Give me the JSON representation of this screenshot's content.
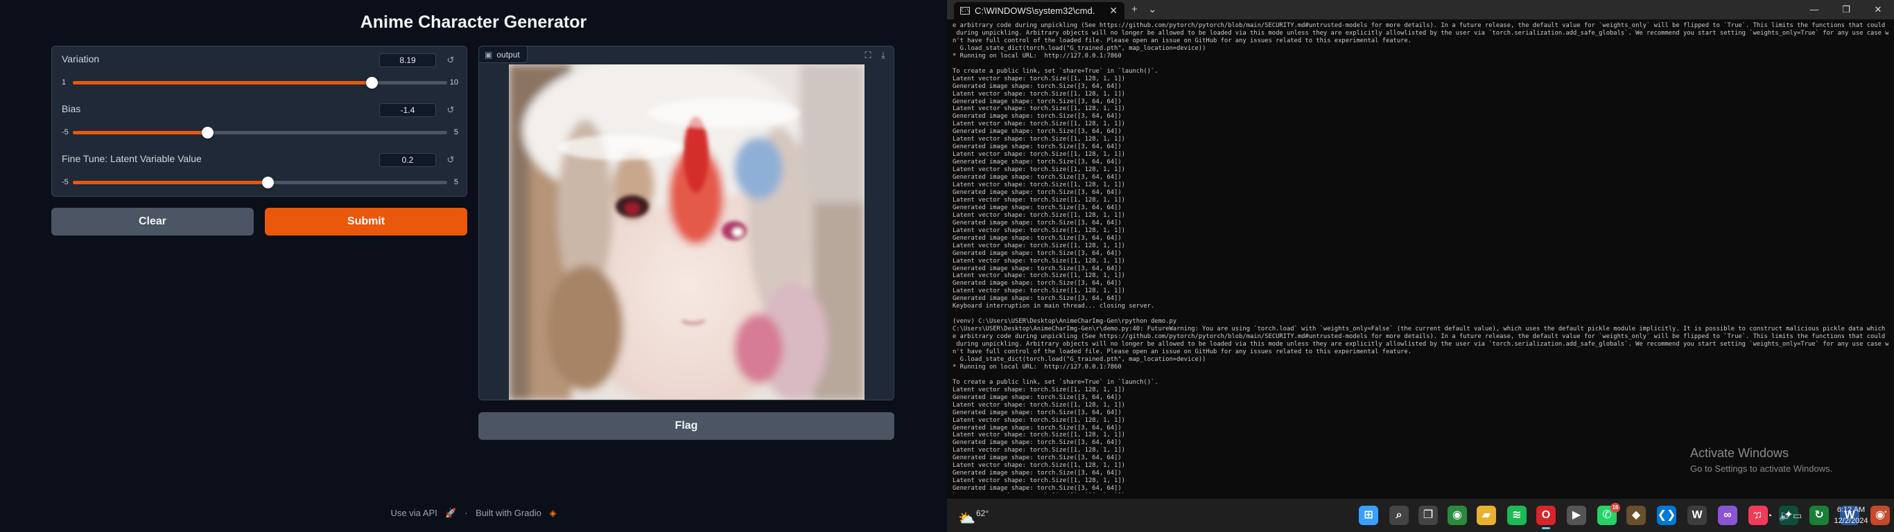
{
  "gradio": {
    "title": "Anime Character Generator",
    "sliders": [
      {
        "label": "Variation",
        "value": "8.19",
        "min": "1",
        "max": "10",
        "fraction": 0.799
      },
      {
        "label": "Bias",
        "value": "-1.4",
        "min": "-5",
        "max": "5",
        "fraction": 0.36
      },
      {
        "label": "Fine Tune: Latent Variable Value",
        "value": "0.2",
        "min": "-5",
        "max": "5",
        "fraction": 0.52
      }
    ],
    "clear_label": "Clear",
    "submit_label": "Submit",
    "output_label": "output",
    "flag_label": "Flag",
    "footer": {
      "api": "Use via API",
      "sep": "·",
      "built": "Built with Gradio"
    },
    "colors": {
      "accent": "#ea580c",
      "panel": "#1f2937",
      "background": "#0b0f19"
    }
  },
  "cmd": {
    "tab_title": "C:\\WINDOWS\\system32\\cmd.",
    "new_tab": "+",
    "dropdown": "⌄",
    "lines": [
      "e arbitrary code during unpickling (See https://github.com/pytorch/pytorch/blob/main/SECURITY.md#untrusted-models for more details). In a future release, the default value for `weights_only` will be flipped to `True`. This limits the functions that could be executed",
      " during unpickling. Arbitrary objects will no longer be allowed to be loaded via this mode unless they are explicitly allowlisted by the user via `torch.serialization.add_safe_globals`. We recommend you start setting `weights_only=True` for any use case where you do",
      "n't have full control of the loaded file. Please open an issue on GitHub for any issues related to this experimental feature.",
      "  G.load_state_dict(torch.load(\"G_trained.pth\", map_location=device))",
      "* Running on local URL:  http://127.0.0.1:7860",
      "",
      "To create a public link, set `share=True` in `launch()`.",
      "Latent vector shape: torch.Size([1, 128, 1, 1])",
      "Generated image shape: torch.Size([3, 64, 64])",
      "Latent vector shape: torch.Size([1, 128, 1, 1])",
      "Generated image shape: torch.Size([3, 64, 64])",
      "Latent vector shape: torch.Size([1, 128, 1, 1])",
      "Generated image shape: torch.Size([3, 64, 64])",
      "Latent vector shape: torch.Size([1, 128, 1, 1])",
      "Generated image shape: torch.Size([3, 64, 64])",
      "Latent vector shape: torch.Size([1, 128, 1, 1])",
      "Generated image shape: torch.Size([3, 64, 64])",
      "Latent vector shape: torch.Size([1, 128, 1, 1])",
      "Generated image shape: torch.Size([3, 64, 64])",
      "Latent vector shape: torch.Size([1, 128, 1, 1])",
      "Generated image shape: torch.Size([3, 64, 64])",
      "Latent vector shape: torch.Size([1, 128, 1, 1])",
      "Generated image shape: torch.Size([3, 64, 64])",
      "Latent vector shape: torch.Size([1, 128, 1, 1])",
      "Generated image shape: torch.Size([3, 64, 64])",
      "Latent vector shape: torch.Size([1, 128, 1, 1])",
      "Generated image shape: torch.Size([3, 64, 64])",
      "Latent vector shape: torch.Size([1, 128, 1, 1])",
      "Generated image shape: torch.Size([3, 64, 64])",
      "Latent vector shape: torch.Size([1, 128, 1, 1])",
      "Generated image shape: torch.Size([3, 64, 64])",
      "Latent vector shape: torch.Size([1, 128, 1, 1])",
      "Generated image shape: torch.Size([3, 64, 64])",
      "Latent vector shape: torch.Size([1, 128, 1, 1])",
      "Generated image shape: torch.Size([3, 64, 64])",
      "Latent vector shape: torch.Size([1, 128, 1, 1])",
      "Generated image shape: torch.Size([3, 64, 64])",
      "Keyboard interruption in main thread... closing server.",
      "",
      "(venv) C:\\Users\\USER\\Desktop\\AnimeCharImg-Gen\\rpython demo.py",
      "C:\\Users\\USER\\Desktop\\AnimeCharImg-Gen\\r\\demo.py:40: FutureWarning: You are using `torch.load` with `weights_only=False` (the current default value), which uses the default pickle module implicitly. It is possible to construct malicious pickle data which will execut",
      "e arbitrary code during unpickling (See https://github.com/pytorch/pytorch/blob/main/SECURITY.md#untrusted-models for more details). In a future release, the default value for `weights_only` will be flipped to `True`. This limits the functions that could be executed",
      " during unpickling. Arbitrary objects will no longer be allowed to be loaded via this mode unless they are explicitly allowlisted by the user via `torch.serialization.add_safe_globals`. We recommend you start setting `weights_only=True` for any use case where you do",
      "n't have full control of the loaded file. Please open an issue on GitHub for any issues related to this experimental feature.",
      "  G.load_state_dict(torch.load(\"G_trained.pth\", map_location=device))",
      "* Running on local URL:  http://127.0.0.1:7860",
      "",
      "To create a public link, set `share=True` in `launch()`.",
      "Latent vector shape: torch.Size([1, 128, 1, 1])",
      "Generated image shape: torch.Size([3, 64, 64])",
      "Latent vector shape: torch.Size([1, 128, 1, 1])",
      "Generated image shape: torch.Size([3, 64, 64])",
      "Latent vector shape: torch.Size([1, 128, 1, 1])",
      "Generated image shape: torch.Size([3, 64, 64])",
      "Latent vector shape: torch.Size([1, 128, 1, 1])",
      "Generated image shape: torch.Size([3, 64, 64])",
      "Latent vector shape: torch.Size([1, 128, 1, 1])",
      "Generated image shape: torch.Size([3, 64, 64])",
      "Latent vector shape: torch.Size([1, 128, 1, 1])",
      "Generated image shape: torch.Size([3, 64, 64])",
      "Latent vector shape: torch.Size([1, 128, 1, 1])",
      "Generated image shape: torch.Size([3, 64, 64])",
      "Latent vector shape: torch.Size([1, 128, 1, 1])",
      "Generated image shape: torch.Size([3, 64, 64])",
      "_"
    ],
    "watermark": {
      "line1": "Activate Windows",
      "line2": "Go to Settings to activate Windows."
    }
  },
  "taskbar": {
    "weather_temp": "62°",
    "icons": [
      {
        "name": "windows-start",
        "glyph": "⊞",
        "color": "#3aa0ff"
      },
      {
        "name": "search",
        "glyph": "⌕",
        "color": "#444444"
      },
      {
        "name": "task-view",
        "glyph": "❐",
        "color": "#444444"
      },
      {
        "name": "chrome",
        "glyph": "◉",
        "color": "#2a8a3e"
      },
      {
        "name": "file-explorer",
        "glyph": "▰",
        "color": "#e8b130"
      },
      {
        "name": "spotify",
        "glyph": "≋",
        "color": "#1db954"
      },
      {
        "name": "opera",
        "glyph": "O",
        "color": "#d6252b"
      },
      {
        "name": "media-player",
        "glyph": "▶",
        "color": "#555555"
      },
      {
        "name": "whatsapp",
        "glyph": "✆",
        "color": "#25d366"
      },
      {
        "name": "git",
        "glyph": "◆",
        "color": "#6a4f2c"
      },
      {
        "name": "vscode",
        "glyph": "❮❯",
        "color": "#0078d4"
      },
      {
        "name": "wordpress",
        "glyph": "W",
        "color": "#3d3d3d"
      },
      {
        "name": "visual-studio",
        "glyph": "∞",
        "color": "#8a55d4"
      },
      {
        "name": "music",
        "glyph": "♫",
        "color": "#f23a5b"
      },
      {
        "name": "robinhood",
        "glyph": "✦",
        "color": "#0e4d3a"
      },
      {
        "name": "refresh-app",
        "glyph": "↻",
        "color": "#1a7f37"
      },
      {
        "name": "word",
        "glyph": "W",
        "color": "#2b579a"
      },
      {
        "name": "chrome-alt",
        "glyph": "◉",
        "color": "#c44a2a"
      },
      {
        "name": "terminal",
        "glyph": ">_",
        "color": "#2d2d2d"
      },
      {
        "name": "vlc",
        "glyph": "▲",
        "color": "#f08a00"
      }
    ],
    "whatsapp_badge": "16",
    "time": "6:12 AM",
    "date": "12/2/2024"
  }
}
